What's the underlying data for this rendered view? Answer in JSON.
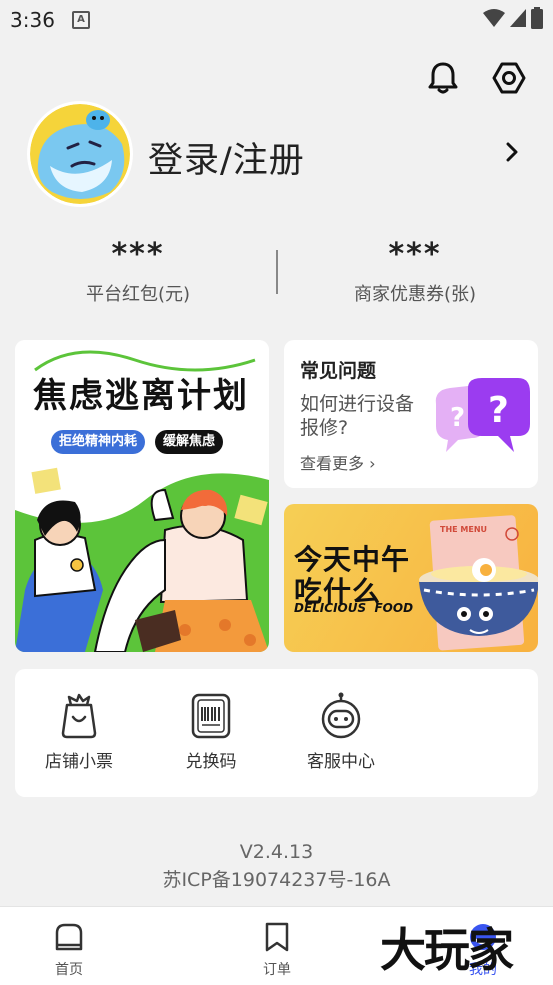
{
  "status_bar": {
    "time": "3:36",
    "notif_badge": "A"
  },
  "header": {
    "icons": [
      "bell-icon",
      "settings-hex-icon"
    ]
  },
  "profile": {
    "login_label": "登录/注册"
  },
  "stats": [
    {
      "value": "***",
      "label": "平台红包(元)"
    },
    {
      "value": "***",
      "label": "商家优惠券(张)"
    }
  ],
  "promo_left": {
    "title": "焦虑逃离计划",
    "tag1": "拒绝精神内耗",
    "tag2": "缓解焦虑"
  },
  "faq": {
    "heading": "常见问题",
    "question": "如何进行设备报修?",
    "more": "查看更多 ›"
  },
  "lunch": {
    "title": "今天中午\n吃什么",
    "subtitle": "DELICIOUS  FOOD",
    "menu_label": "THE MENU"
  },
  "services": [
    {
      "label": "店铺小票",
      "icon": "receipt-bag-icon"
    },
    {
      "label": "兑换码",
      "icon": "barcode-icon"
    },
    {
      "label": "客服中心",
      "icon": "robot-service-icon"
    }
  ],
  "footer": {
    "version": "V2.4.13",
    "icp": "苏ICP备19074237号-16A"
  },
  "tabbar": [
    {
      "label": "首页",
      "icon": "home-icon",
      "active": false
    },
    {
      "label": "订单",
      "icon": "bookmark-icon",
      "active": false
    },
    {
      "label": "我的",
      "icon": "profile-icon",
      "active": true
    }
  ],
  "watermark": "大玩家",
  "colors": {
    "accent": "#3a55f0",
    "background": "#f1f1f1"
  }
}
